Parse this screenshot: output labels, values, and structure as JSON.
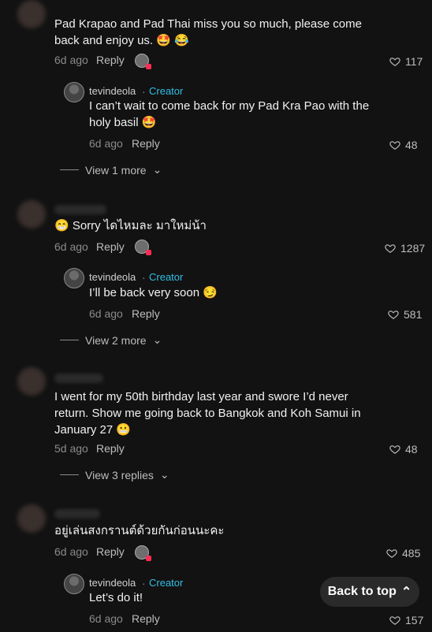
{
  "comments": [
    {
      "text": "Pad Krapao and Pad Thai miss you so much, please come back and enjoy us. 🤩 😂",
      "time": "6d ago",
      "reply": "Reply",
      "likes": "117",
      "reply_item": {
        "handle": "tevindeola",
        "badge": "Creator",
        "text": "I can’t wait to come back for my Pad Kra Pao with the holy basil 🤩",
        "time": "6d ago",
        "reply": "Reply",
        "likes": "48"
      },
      "view_more": "View 1 more"
    },
    {
      "text": "😁 Sorry ไดไหมละ มาใหม่น้า",
      "time": "6d ago",
      "reply": "Reply",
      "likes": "1287",
      "reply_item": {
        "handle": "tevindeola",
        "badge": "Creator",
        "text": "I’ll be back very soon 😏",
        "time": "6d ago",
        "reply": "Reply",
        "likes": "581"
      },
      "view_more": "View 2 more"
    },
    {
      "text": "I went for my 50th birthday last year and swore I’d never return. Show me going back to Bangkok and Koh Samui in January 27 😬",
      "time": "5d ago",
      "reply": "Reply",
      "likes": "48",
      "view_more": "View 3 replies"
    },
    {
      "text": "อยู่เล่นสงกรานต์ด้วยกันก่อนนะคะ",
      "time": "6d ago",
      "reply": "Reply",
      "likes": "485",
      "reply_item": {
        "handle": "tevindeola",
        "badge": "Creator",
        "text": "Let’s do it!",
        "time": "6d ago",
        "reply": "Reply",
        "likes": "157"
      }
    }
  ],
  "back_to_top": "Back to top",
  "icons": [
    "heart-outline-icon",
    "chevron-down-icon",
    "double-chevron-up-icon"
  ],
  "colors": {
    "background": "#121212",
    "creator": "#31bfe6",
    "badge": "#fe2c55"
  }
}
